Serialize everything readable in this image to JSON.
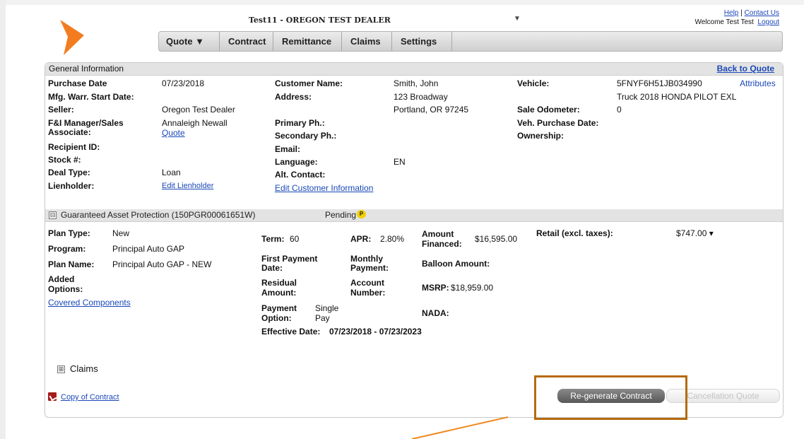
{
  "header": {
    "dealer_title": "Test11 - OREGON TEST DEALER",
    "dealer_caret": "▼",
    "help_link": "Help",
    "separator": "|",
    "contact_link": "Contact Us",
    "welcome_text": "Welcome Test Test",
    "logout_link": "Logout",
    "brand_color": "#f47c20"
  },
  "nav": {
    "quote": "Quote ▼",
    "contract": "Contract",
    "remittance": "Remittance",
    "claims": "Claims",
    "settings": "Settings"
  },
  "general": {
    "title": "General Information",
    "back_link": "Back to Quote",
    "purchase_date_label": "Purchase Date",
    "purchase_date": "07/23/2018",
    "mfg_warr_label": "Mfg. Warr. Start Date:",
    "seller_label": "Seller:",
    "seller": "Oregon Test Dealer",
    "fi_label_1": "F&I Manager/Sales",
    "fi_label_2": "Associate:",
    "fi_value": "Annaleigh Newall",
    "fi_link": "Quote",
    "recipient_label": "Recipient ID:",
    "stock_label": "Stock #:",
    "deal_type_label": "Deal Type:",
    "deal_type": "Loan",
    "lienholder_label": "Lienholder:",
    "edit_lienholder": "Edit Lienholder",
    "customer_name_label": "Customer Name:",
    "customer_name": "Smith, John",
    "address_label": "Address:",
    "address_1": "123 Broadway",
    "address_2": "Portland, OR 97245",
    "primary_ph_label": "Primary Ph.:",
    "secondary_ph_label": "Secondary Ph.:",
    "email_label": "Email:",
    "language_label": "Language:",
    "language": "EN",
    "alt_contact_label": "Alt. Contact:",
    "edit_customer": "Edit Customer Information",
    "vehicle_label": "Vehicle:",
    "vin": "5FNYF6H51JB034990",
    "attributes_link": "Attributes",
    "vehicle_desc": "Truck 2018 HONDA PILOT EXL",
    "sale_odometer_label": "Sale Odometer:",
    "sale_odometer": "0",
    "veh_purchase_label": "Veh. Purchase Date:",
    "ownership_label": "Ownership:"
  },
  "gap": {
    "toggle": "⊟",
    "title": "Guaranteed Asset Protection (150PGR00061651W)",
    "status": "Pending",
    "status_badge": "P",
    "plan_type_label": "Plan Type:",
    "plan_type": "New",
    "program_label": "Program:",
    "program": "Principal Auto GAP",
    "plan_name_label": "Plan Name:",
    "plan_name": "Principal Auto GAP - NEW",
    "added_label_1": "Added",
    "added_label_2": "Options:",
    "covered_components": "Covered Components",
    "term_label": "Term:",
    "term": "60",
    "apr_label": "APR:",
    "apr": "2.80%",
    "amount_fin_label_1": "Amount",
    "amount_fin_label_2": "Financed:",
    "amount_financed": "$16,595.00",
    "retail_label": "Retail (excl. taxes):",
    "retail": "$747.00 ▾",
    "first_payment_1": "First Payment",
    "first_payment_2": "Date:",
    "monthly_1": "Monthly",
    "monthly_2": "Payment:",
    "balloon_label": "Balloon Amount:",
    "residual_1": "Residual",
    "residual_2": "Amount:",
    "account_1": "Account",
    "account_2": "Number:",
    "msrp_label": "MSRP:",
    "msrp": "$18,959.00",
    "payment_option_1": "Payment",
    "payment_option_2": "Option:",
    "payment_option_v1": "Single",
    "payment_option_v2": "Pay",
    "nada_label": "NADA:",
    "effective_label": "Effective Date:",
    "effective": "07/23/2018 - 07/23/2023"
  },
  "claims": {
    "toggle": "⊞",
    "label": "Claims"
  },
  "actions": {
    "copy_contract": "Copy of Contract",
    "regenerate": "Re-generate Contract",
    "cancellation": "Cancellation Quote",
    "highlight_color": "#b66a0e"
  }
}
